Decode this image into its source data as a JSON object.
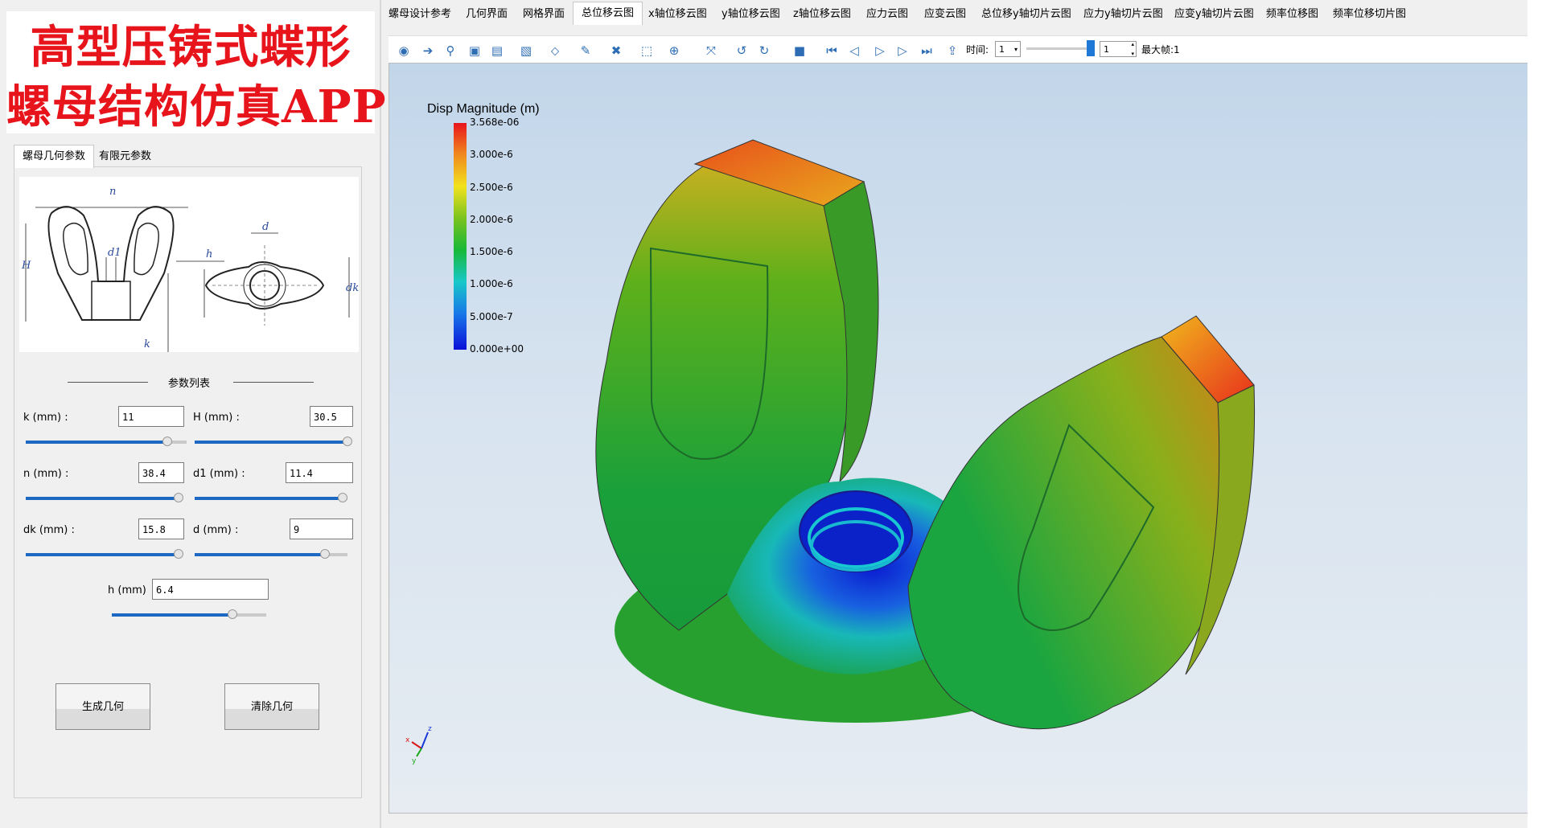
{
  "app_title": {
    "line1": "高型压铸式蝶形",
    "line2": "螺母结构仿真APP"
  },
  "left_tabs": [
    {
      "label": "螺母几何参数"
    },
    {
      "label": "有限元参数"
    }
  ],
  "diagram_labels": {
    "n": "n",
    "H": "H",
    "d1": "d1",
    "k": "k",
    "h": "h",
    "d": "d",
    "dk": "dk"
  },
  "params": {
    "section_title": "参数列表",
    "k": {
      "label": "k (mm) :",
      "value": "11",
      "slider": 0.88
    },
    "H": {
      "label": "H (mm) :",
      "value": "30.5",
      "slider": 1.0
    },
    "n": {
      "label": "n (mm) :",
      "value": "38.4",
      "slider": 1.0
    },
    "d1": {
      "label": "d1 (mm) :",
      "value": "11.4",
      "slider": 0.97
    },
    "dk": {
      "label": "dk (mm) :",
      "value": "15.8",
      "slider": 1.0
    },
    "d": {
      "label": "d (mm) :",
      "value": "9",
      "slider": 0.85
    },
    "h": {
      "label": "h (mm)",
      "value": "6.4",
      "slider": 0.78
    }
  },
  "buttons": {
    "generate": "生成几何",
    "clear": "清除几何"
  },
  "top_tabs": [
    {
      "label": "螺母设计参考"
    },
    {
      "label": "几何界面"
    },
    {
      "label": "网格界面"
    },
    {
      "label": "总位移云图"
    },
    {
      "label": "x轴位移云图"
    },
    {
      "label": "y轴位移云图"
    },
    {
      "label": "z轴位移云图"
    },
    {
      "label": "应力云图"
    },
    {
      "label": "应变云图"
    },
    {
      "label": "总位移y轴切片云图"
    },
    {
      "label": "应力y轴切片云图"
    },
    {
      "label": "应变y轴切片云图"
    },
    {
      "label": "频率位移图"
    },
    {
      "label": "频率位移切片图"
    }
  ],
  "active_top_tab": "总位移云图",
  "toolbar": {
    "time_label": "时间:",
    "time_value": "1",
    "frame_value": "1",
    "max_frame": "最大帧:1",
    "icons": [
      "camera-icon",
      "export-icon",
      "zoom-icon",
      "fit-icon",
      "view-icon",
      "folder-icon",
      "filter-icon",
      "brush-icon",
      "delete-icon",
      "select-icon",
      "pick-icon",
      "axis-icon",
      "rotate-left-icon",
      "rotate-right-icon",
      "record-icon",
      "first-frame-icon",
      "prev-frame-icon",
      "play-icon",
      "next-frame-icon",
      "last-frame-icon",
      "loop-icon"
    ]
  },
  "legend": {
    "title": "Disp Magnitude (m)",
    "ticks": [
      "3.568e-06",
      "3.000e-6",
      "2.500e-6",
      "2.000e-6",
      "1.500e-6",
      "1.000e-6",
      "5.000e-7",
      "0.000e+00"
    ],
    "colors": [
      "#e8141c",
      "#f08a1e",
      "#f2e21e",
      "#7ac31e",
      "#18b838",
      "#18c8c8",
      "#1878e8",
      "#0a10d8"
    ]
  },
  "axes_labels": {
    "x": "x",
    "y": "y",
    "z": "z"
  }
}
